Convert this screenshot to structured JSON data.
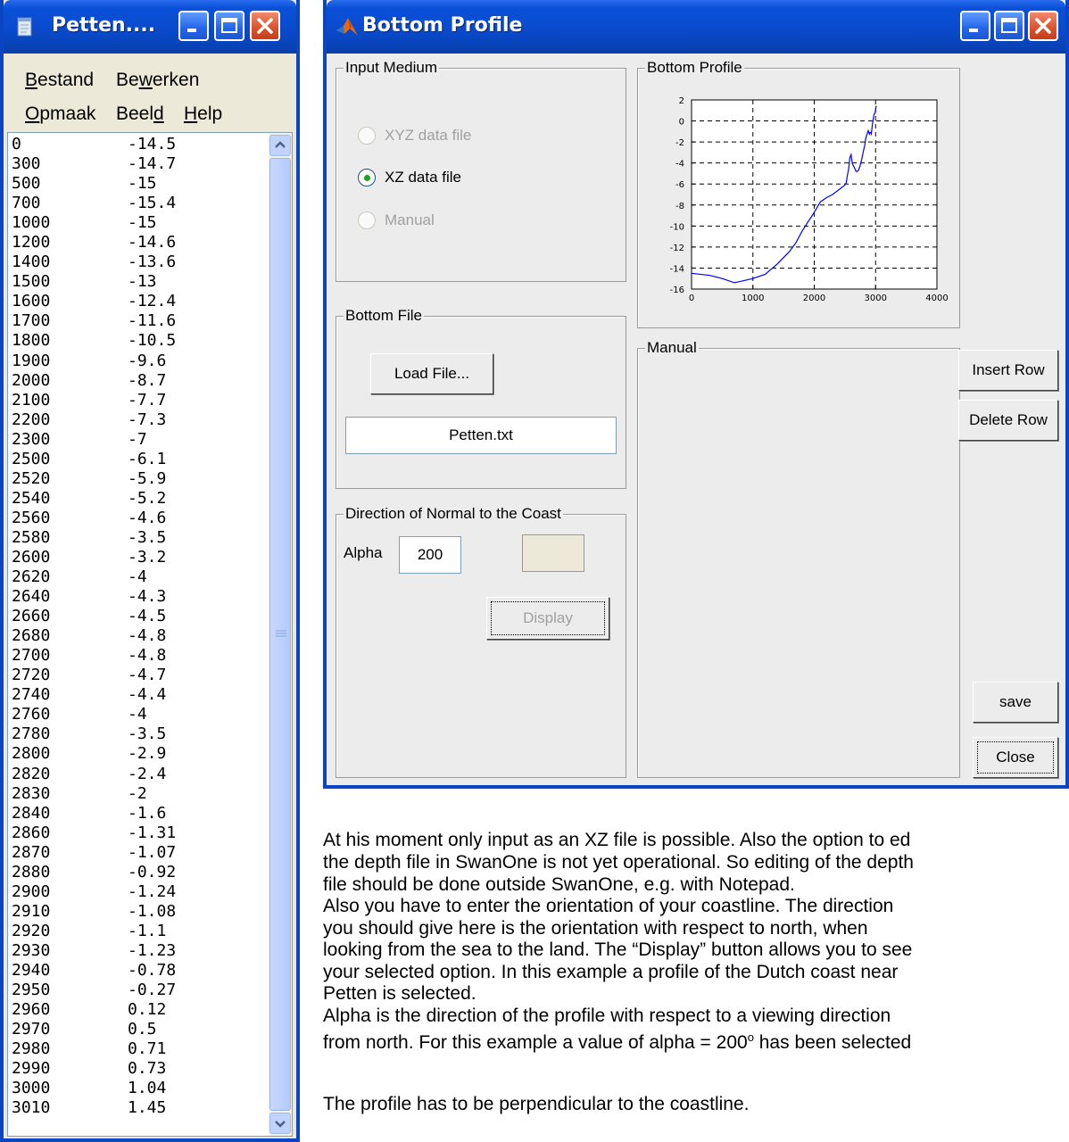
{
  "notepad": {
    "title": "Petten....",
    "menu": {
      "row1": [
        {
          "u": "B",
          "rest": "estand"
        },
        {
          "pre": "Be",
          "u": "w",
          "rest": "erken"
        }
      ],
      "row2": [
        {
          "u": "O",
          "rest": "pmaak"
        },
        {
          "pre": "Beel",
          "u": "d",
          "rest": ""
        },
        {
          "u": "H",
          "rest": "elp"
        }
      ]
    },
    "rows": [
      [
        "0",
        "-14.5"
      ],
      [
        "300",
        "-14.7"
      ],
      [
        "500",
        "-15"
      ],
      [
        "700",
        "-15.4"
      ],
      [
        "1000",
        "-15"
      ],
      [
        "1200",
        "-14.6"
      ],
      [
        "1400",
        "-13.6"
      ],
      [
        "1500",
        "-13"
      ],
      [
        "1600",
        "-12.4"
      ],
      [
        "1700",
        "-11.6"
      ],
      [
        "1800",
        "-10.5"
      ],
      [
        "1900",
        "-9.6"
      ],
      [
        "2000",
        "-8.7"
      ],
      [
        "2100",
        "-7.7"
      ],
      [
        "2200",
        "-7.3"
      ],
      [
        "2300",
        "-7"
      ],
      [
        "2500",
        "-6.1"
      ],
      [
        "2520",
        "-5.9"
      ],
      [
        "2540",
        "-5.2"
      ],
      [
        "2560",
        "-4.6"
      ],
      [
        "2580",
        "-3.5"
      ],
      [
        "2600",
        "-3.2"
      ],
      [
        "2620",
        "-4"
      ],
      [
        "2640",
        "-4.3"
      ],
      [
        "2660",
        "-4.5"
      ],
      [
        "2680",
        "-4.8"
      ],
      [
        "2700",
        "-4.8"
      ],
      [
        "2720",
        "-4.7"
      ],
      [
        "2740",
        "-4.4"
      ],
      [
        "2760",
        "-4"
      ],
      [
        "2780",
        "-3.5"
      ],
      [
        "2800",
        "-2.9"
      ],
      [
        "2820",
        "-2.4"
      ],
      [
        "2830",
        "-2"
      ],
      [
        "2840",
        "-1.6"
      ],
      [
        "2860",
        "-1.31"
      ],
      [
        "2870",
        "-1.07"
      ],
      [
        "2880",
        "-0.92"
      ],
      [
        "2900",
        "-1.24"
      ],
      [
        "2910",
        "-1.08"
      ],
      [
        "2920",
        "-1.1"
      ],
      [
        "2930",
        "-1.23"
      ],
      [
        "2940",
        "-0.78"
      ],
      [
        "2950",
        "-0.27"
      ],
      [
        "2960",
        "0.12"
      ],
      [
        "2970",
        "0.5"
      ],
      [
        "2980",
        "0.71"
      ],
      [
        "2990",
        "0.73"
      ],
      [
        "3000",
        "1.04"
      ],
      [
        "3010",
        "1.45"
      ]
    ]
  },
  "bottom_profile": {
    "title": "Bottom Profile",
    "input_medium": {
      "title": "Input Medium",
      "options": [
        "XYZ data file",
        "XZ data file",
        "Manual"
      ],
      "selected": "XZ data file"
    },
    "plot_panel_title": "Bottom Profile",
    "bottom_file": {
      "title": "Bottom File",
      "load_button": "Load File...",
      "filename": "Petten.txt"
    },
    "direction": {
      "title": "Direction of Normal to the Coast",
      "alpha_label": "Alpha",
      "alpha_value": "200",
      "display_button": "Display"
    },
    "manual_panel_title": "Manual",
    "buttons": {
      "insert_row": "Insert Row",
      "delete_row": "Delete Row",
      "save": "save",
      "close": "Close"
    },
    "colors": {
      "line": "#0000ff",
      "titlebar": "#0a4ccf",
      "close_button": "#d8522d"
    }
  },
  "chart_data": {
    "type": "line",
    "x_ticks": [
      "0",
      "1000",
      "2000",
      "3000",
      "4000"
    ],
    "y_ticks": [
      "2",
      "0",
      "-2",
      "-4",
      "-6",
      "-8",
      "-10",
      "-12",
      "-14",
      "-16"
    ],
    "xlim": [
      0,
      4000
    ],
    "ylim": [
      -16,
      2
    ],
    "grid": true,
    "series": [
      {
        "color": "#0000ff",
        "x": [
          0,
          300,
          500,
          700,
          1000,
          1200,
          1400,
          1500,
          1600,
          1700,
          1800,
          1900,
          2000,
          2100,
          2200,
          2300,
          2500,
          2520,
          2540,
          2560,
          2580,
          2600,
          2620,
          2640,
          2660,
          2680,
          2700,
          2720,
          2740,
          2760,
          2780,
          2800,
          2820,
          2830,
          2840,
          2860,
          2870,
          2880,
          2900,
          2910,
          2920,
          2930,
          2940,
          2950,
          2960,
          2970,
          2980,
          2990,
          3000,
          3010
        ],
        "y": [
          -14.5,
          -14.7,
          -15,
          -15.4,
          -15,
          -14.6,
          -13.6,
          -13,
          -12.4,
          -11.6,
          -10.5,
          -9.6,
          -8.7,
          -7.7,
          -7.3,
          -7,
          -6.1,
          -5.9,
          -5.2,
          -4.6,
          -3.5,
          -3.2,
          -4,
          -4.3,
          -4.5,
          -4.8,
          -4.8,
          -4.7,
          -4.4,
          -4,
          -3.5,
          -2.9,
          -2.4,
          -2,
          -1.6,
          -1.31,
          -1.07,
          -0.92,
          -1.24,
          -1.08,
          -1.1,
          -1.23,
          -0.78,
          -0.27,
          0.12,
          0.5,
          0.71,
          0.73,
          1.04,
          1.45
        ]
      }
    ]
  },
  "doc": {
    "lines": [
      "At his moment only input as an XZ file is possible. Also the option to ed",
      "the depth file in SwanOne is not yet operational. So editing of the depth",
      "file should be done outside SwanOne, e.g. with Notepad.",
      "Also you have to enter the orientation of your coastline. The direction",
      "you should give here is the orientation with respect to north, when",
      "looking from the sea to the land. The “Display” button allows you to see",
      "your selected option. In this example a profile of the Dutch coast near",
      "Petten is selected.",
      "Alpha is the direction of the profile with respect to a viewing direction"
    ],
    "alpha_line_before": "from north. For this example a value of alpha = 200",
    "alpha_line_sup": "o",
    "alpha_line_after": " has been selected",
    "last_line": "The profile has to be perpendicular to the coastline."
  }
}
